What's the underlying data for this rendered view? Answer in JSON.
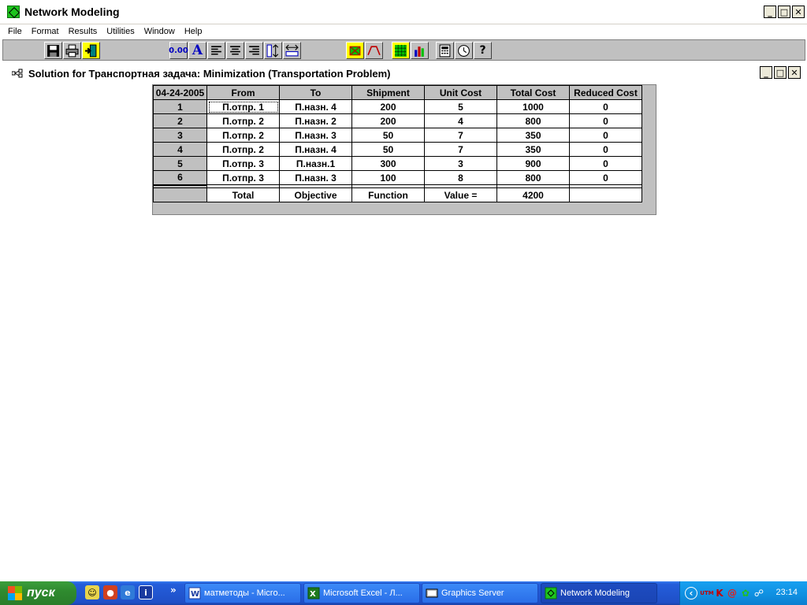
{
  "app": {
    "title": "Network Modeling",
    "menu": [
      "File",
      "Format",
      "Results",
      "Utilities",
      "Window",
      "Help"
    ],
    "toolbar_decimal_label": "0.00",
    "toolbar_font_label": "A"
  },
  "child_window": {
    "title": "Solution for Транспортная задача: Minimization (Transportation Problem)"
  },
  "grid": {
    "corner": "04-24-2005",
    "headers": [
      "From",
      "To",
      "Shipment",
      "Unit Cost",
      "Total Cost",
      "Reduced Cost"
    ],
    "rows": [
      {
        "n": "1",
        "from": "П.отпр. 1",
        "to": "П.назн. 4",
        "shipment": "200",
        "unit_cost": "5",
        "total_cost": "1000",
        "reduced_cost": "0"
      },
      {
        "n": "2",
        "from": "П.отпр. 2",
        "to": "П.назн. 2",
        "shipment": "200",
        "unit_cost": "4",
        "total_cost": "800",
        "reduced_cost": "0"
      },
      {
        "n": "3",
        "from": "П.отпр. 2",
        "to": "П.назн. 3",
        "shipment": "50",
        "unit_cost": "7",
        "total_cost": "350",
        "reduced_cost": "0"
      },
      {
        "n": "4",
        "from": "П.отпр. 2",
        "to": "П.назн. 4",
        "shipment": "50",
        "unit_cost": "7",
        "total_cost": "350",
        "reduced_cost": "0"
      },
      {
        "n": "5",
        "from": "П.отпр. 3",
        "to": "П.назн.1",
        "shipment": "300",
        "unit_cost": "3",
        "total_cost": "900",
        "reduced_cost": "0"
      },
      {
        "n": "6",
        "from": "П.отпр. 3",
        "to": "П.назн. 3",
        "shipment": "100",
        "unit_cost": "8",
        "total_cost": "800",
        "reduced_cost": "0"
      }
    ],
    "total_row": [
      "Total",
      "Objective",
      "Function",
      "Value =",
      "4200",
      ""
    ]
  },
  "taskbar": {
    "start_label": "пуск",
    "tasks": [
      {
        "label": "матметоды - Micro...",
        "active": false
      },
      {
        "label": "Microsoft Excel - Л...",
        "active": false
      },
      {
        "label": "Graphics Server",
        "active": false
      },
      {
        "label": "Network Modeling",
        "active": true
      }
    ],
    "chevron": "»",
    "tray_utm": "UTM",
    "clock": "23:14"
  }
}
